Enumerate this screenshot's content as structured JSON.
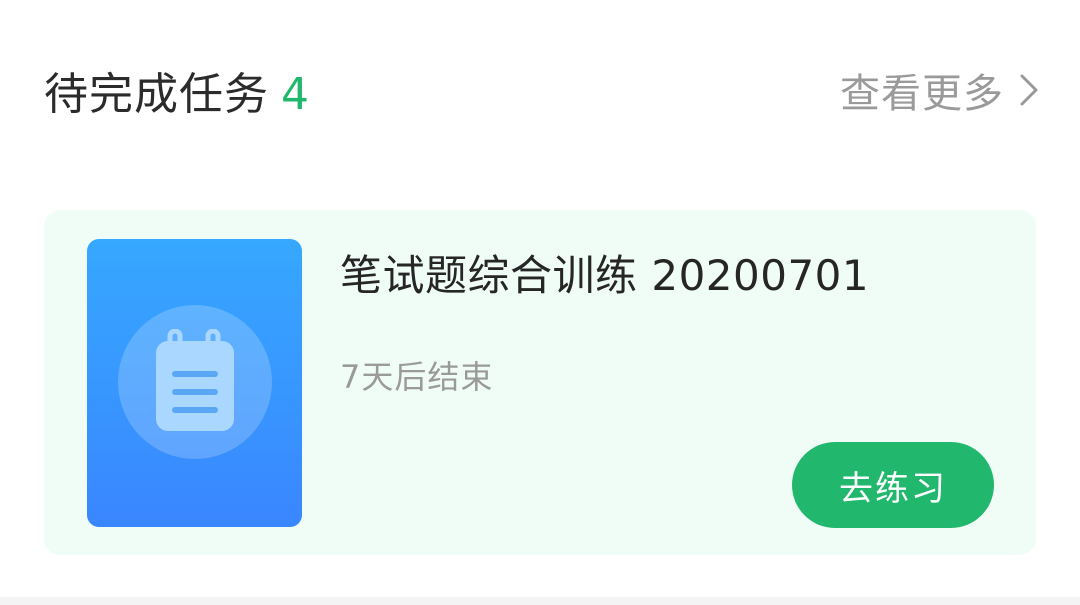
{
  "header": {
    "title": "待完成任务",
    "count": "4",
    "more_label": "查看更多"
  },
  "task": {
    "title": "笔试题综合训练 20200701",
    "deadline": "7天后结束",
    "action_label": "去练习",
    "icon": "clipboard-icon"
  },
  "colors": {
    "accent": "#21b86d",
    "card_bg": "#f0fdf7",
    "cover_top": "#36a8ff",
    "cover_bottom": "#3a86ff",
    "muted_text": "#9a9a9a",
    "primary_text": "#262626"
  }
}
